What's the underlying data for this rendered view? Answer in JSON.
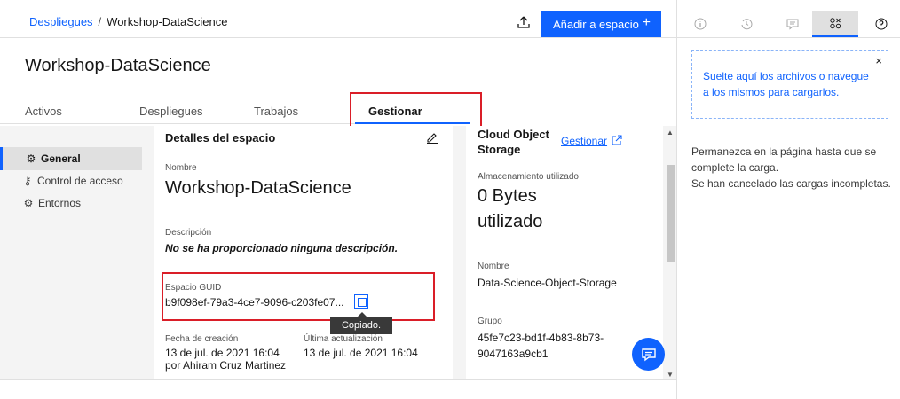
{
  "breadcrumb": {
    "root": "Despliegues",
    "separator": "/",
    "current": "Workshop-DataScience"
  },
  "header": {
    "add_button_label": "Añadir a espacio",
    "add_button_plus": "+"
  },
  "page": {
    "title": "Workshop-DataScience"
  },
  "tabs": [
    {
      "label": "Activos"
    },
    {
      "label": "Despliegues"
    },
    {
      "label": "Trabajos"
    },
    {
      "label": "Gestionar"
    }
  ],
  "leftnav": [
    {
      "label": "General",
      "icon": "gear-icon"
    },
    {
      "label": "Control de acceso",
      "icon": "key-icon"
    },
    {
      "label": "Entornos",
      "icon": "environment-icon"
    }
  ],
  "details": {
    "heading": "Detalles del espacio",
    "name_label": "Nombre",
    "name_value": "Workshop-DataScience",
    "description_label": "Descripción",
    "description_value": "No se ha proporcionado ninguna descripción.",
    "guid_label": "Espacio GUID",
    "guid_value": "b9f098ef-79a3-4ce7-9096-c203fe07...",
    "tooltip": "Copiado.",
    "created_label": "Fecha de creación",
    "created_date": "13 de jul. de 2021 16:04",
    "created_by": "por Ahiram Cruz Martinez",
    "updated_label": "Última actualización",
    "updated_date": "13 de jul. de 2021 16:04"
  },
  "storage": {
    "heading_line1": "Cloud Object",
    "heading_line2": "Storage",
    "manage_label": "Gestionar",
    "used_label": "Almacenamiento utilizado",
    "used_value_line1": "0 Bytes",
    "used_value_line2": "utilizado",
    "name_label": "Nombre",
    "name_value": "Data-Science-Object-Storage",
    "group_label": "Grupo",
    "group_value_line1": "45fe7c23-bd1f-4b83-8b73-",
    "group_value_line2": "9047163a9cb1"
  },
  "rightpanel": {
    "dropzone_text": "Suelte aquí los archivos o navegue a los mismos para cargarlos.",
    "close_label": "×",
    "message_line1": "Permanezca en la página hasta que se complete la carga.",
    "message_line2": "Se han cancelado las cargas incompletas.",
    "tabs": [
      "info-icon",
      "history-icon",
      "comment-icon",
      "assets-icon",
      "help-icon"
    ]
  },
  "colors": {
    "accent": "#0f62fe",
    "highlight": "#da1e28"
  }
}
